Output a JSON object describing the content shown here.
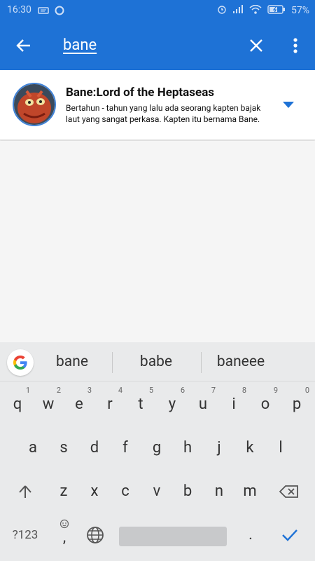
{
  "status_bar": {
    "time": "16:30",
    "battery": "57%"
  },
  "app_bar": {
    "search_text": "bane",
    "colors": {
      "primary": "#1e72d6"
    }
  },
  "result": {
    "title": "Bane:Lord of the Heptaseas",
    "description": "Bertahun - tahun yang lalu ada seorang kapten bajak laut yang sangat perkasa. Kapten itu bernama Bane."
  },
  "keyboard": {
    "suggestions": [
      "bane",
      "babe",
      "baneee"
    ],
    "row1": [
      {
        "k": "q",
        "h": "1"
      },
      {
        "k": "w",
        "h": "2"
      },
      {
        "k": "e",
        "h": "3"
      },
      {
        "k": "r",
        "h": "4"
      },
      {
        "k": "t",
        "h": "5"
      },
      {
        "k": "y",
        "h": "6"
      },
      {
        "k": "u",
        "h": "7"
      },
      {
        "k": "i",
        "h": "8"
      },
      {
        "k": "o",
        "h": "9"
      },
      {
        "k": "p",
        "h": "0"
      }
    ],
    "row2": [
      "a",
      "s",
      "d",
      "f",
      "g",
      "h",
      "j",
      "k",
      "l"
    ],
    "row3": [
      "z",
      "x",
      "c",
      "v",
      "b",
      "n",
      "m"
    ],
    "symbols_label": "?123",
    "comma": ",",
    "period": "."
  }
}
